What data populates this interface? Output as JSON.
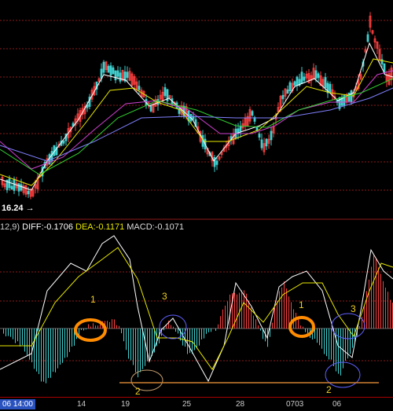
{
  "price_panel": {
    "low_price_label": "16.24",
    "colors": {
      "up": "#ff4040",
      "down": "#40d0d0",
      "ma5": "#ffffff",
      "ma10": "#e8e800",
      "ma20": "#d040d0",
      "ma30": "#30d030",
      "ma60": "#8080ff",
      "grid": "#8b1a1a"
    }
  },
  "macd_panel": {
    "params": "12,9)",
    "diff_label": "DIFF:",
    "diff_value": "-0.1706",
    "dea_label": "DEA:",
    "dea_value": "-0.1171",
    "macd_label": "MACD:",
    "macd_value": "-0.1071",
    "annotations": [
      "1",
      "2",
      "3",
      "1",
      "2",
      "3"
    ]
  },
  "time_axis": {
    "cursor_label": "06 14:00",
    "ticks": [
      "14",
      "19",
      "25",
      "28",
      "0703",
      "06"
    ]
  }
}
